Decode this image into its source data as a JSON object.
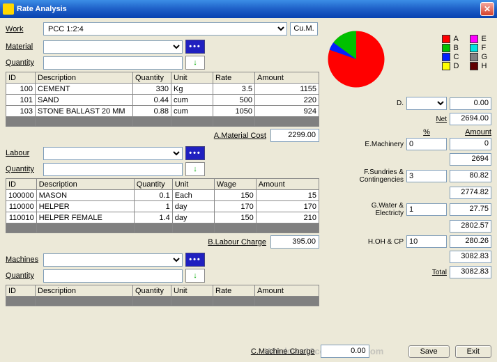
{
  "window": {
    "title": "Rate Analysis"
  },
  "work": {
    "label": "Work",
    "value": "PCC 1:2:4",
    "unit": "Cu.M."
  },
  "material": {
    "label": "Material",
    "qtylabel": "Quantity"
  },
  "mat_table": {
    "cols": [
      "ID",
      "Description",
      "Quantity",
      "Unit",
      "Rate",
      "Amount"
    ],
    "rows": [
      {
        "id": "100",
        "desc": "CEMENT",
        "qty": "330",
        "unit": "Kg",
        "rate": "3.5",
        "amt": "1155"
      },
      {
        "id": "101",
        "desc": "SAND",
        "qty": "0.44",
        "unit": "cum",
        "rate": "500",
        "amt": "220"
      },
      {
        "id": "103",
        "desc": "STONE BALLAST 20 MM",
        "qty": "0.88",
        "unit": "cum",
        "rate": "1050",
        "amt": "924"
      }
    ]
  },
  "labour": {
    "label": "Labour",
    "qtylabel": "Quantity"
  },
  "lab_table": {
    "cols": [
      "ID",
      "Description",
      "Quantity",
      "Unit",
      "Wage",
      "Amount"
    ],
    "rows": [
      {
        "id": "100000",
        "desc": "MASON",
        "qty": "0.1",
        "unit": "Each",
        "rate": "150",
        "amt": "15"
      },
      {
        "id": "110000",
        "desc": "HELPER",
        "qty": "1",
        "unit": "day",
        "rate": "170",
        "amt": "170"
      },
      {
        "id": "110010",
        "desc": "HELPER FEMALE",
        "qty": "1.4",
        "unit": "day",
        "rate": "150",
        "amt": "210"
      }
    ]
  },
  "machines": {
    "label": "Machines",
    "qtylabel": "Quantity"
  },
  "mac_table": {
    "cols": [
      "ID",
      "Description",
      "Quantity",
      "Unit",
      "Rate",
      "Amount"
    ]
  },
  "costs": {
    "matcost": {
      "label": "A.Material Cost",
      "value": "2299.00"
    },
    "labcost": {
      "label": "B.Labour Charge",
      "value": "395.00"
    },
    "maccost": {
      "label": "C.Machine Charge",
      "value": "0.00"
    }
  },
  "legend": {
    "a": "A",
    "b": "B",
    "c": "C",
    "d": "D",
    "e": "E",
    "f": "F",
    "g": "G",
    "h": "H"
  },
  "legend_colors": {
    "a": "#ff0000",
    "b": "#00c000",
    "c": "#0020ff",
    "d": "#ffff00",
    "e": "#ff00ff",
    "f": "#00e0e0",
    "g": "#808080",
    "h": "#600000"
  },
  "chart_data": {
    "type": "pie",
    "series": [
      {
        "name": "A",
        "value": 2299,
        "color": "#ff0000"
      },
      {
        "name": "B",
        "value": 395,
        "color": "#00c000"
      },
      {
        "name": "C",
        "value": 0,
        "color": "#0020ff"
      }
    ],
    "title": ""
  },
  "side": {
    "d": {
      "label": "D.",
      "value": "0.00"
    },
    "net": {
      "label": "Net",
      "value": "2694.00"
    },
    "pct": "%",
    "amt": "Amount",
    "e": {
      "label": "E.Machinery",
      "in": "0",
      "out": "0"
    },
    "sub1": "2694",
    "f": {
      "label": "F.Sundries & Contingencies",
      "in": "3",
      "out": "80.82"
    },
    "sub2": "2774.82",
    "g": {
      "label": "G.Water & Electricty",
      "in": "1",
      "out": "27.75"
    },
    "sub3": "2802.57",
    "h": {
      "label": "H.OH & CP",
      "in": "10",
      "out": "280.26"
    },
    "sub4": "3082.83",
    "total": {
      "label": "Total",
      "value": "3082.83"
    }
  },
  "buttons": {
    "save": "Save",
    "exit": "Exit"
  },
  "watermark": "Windows10compatible.com"
}
